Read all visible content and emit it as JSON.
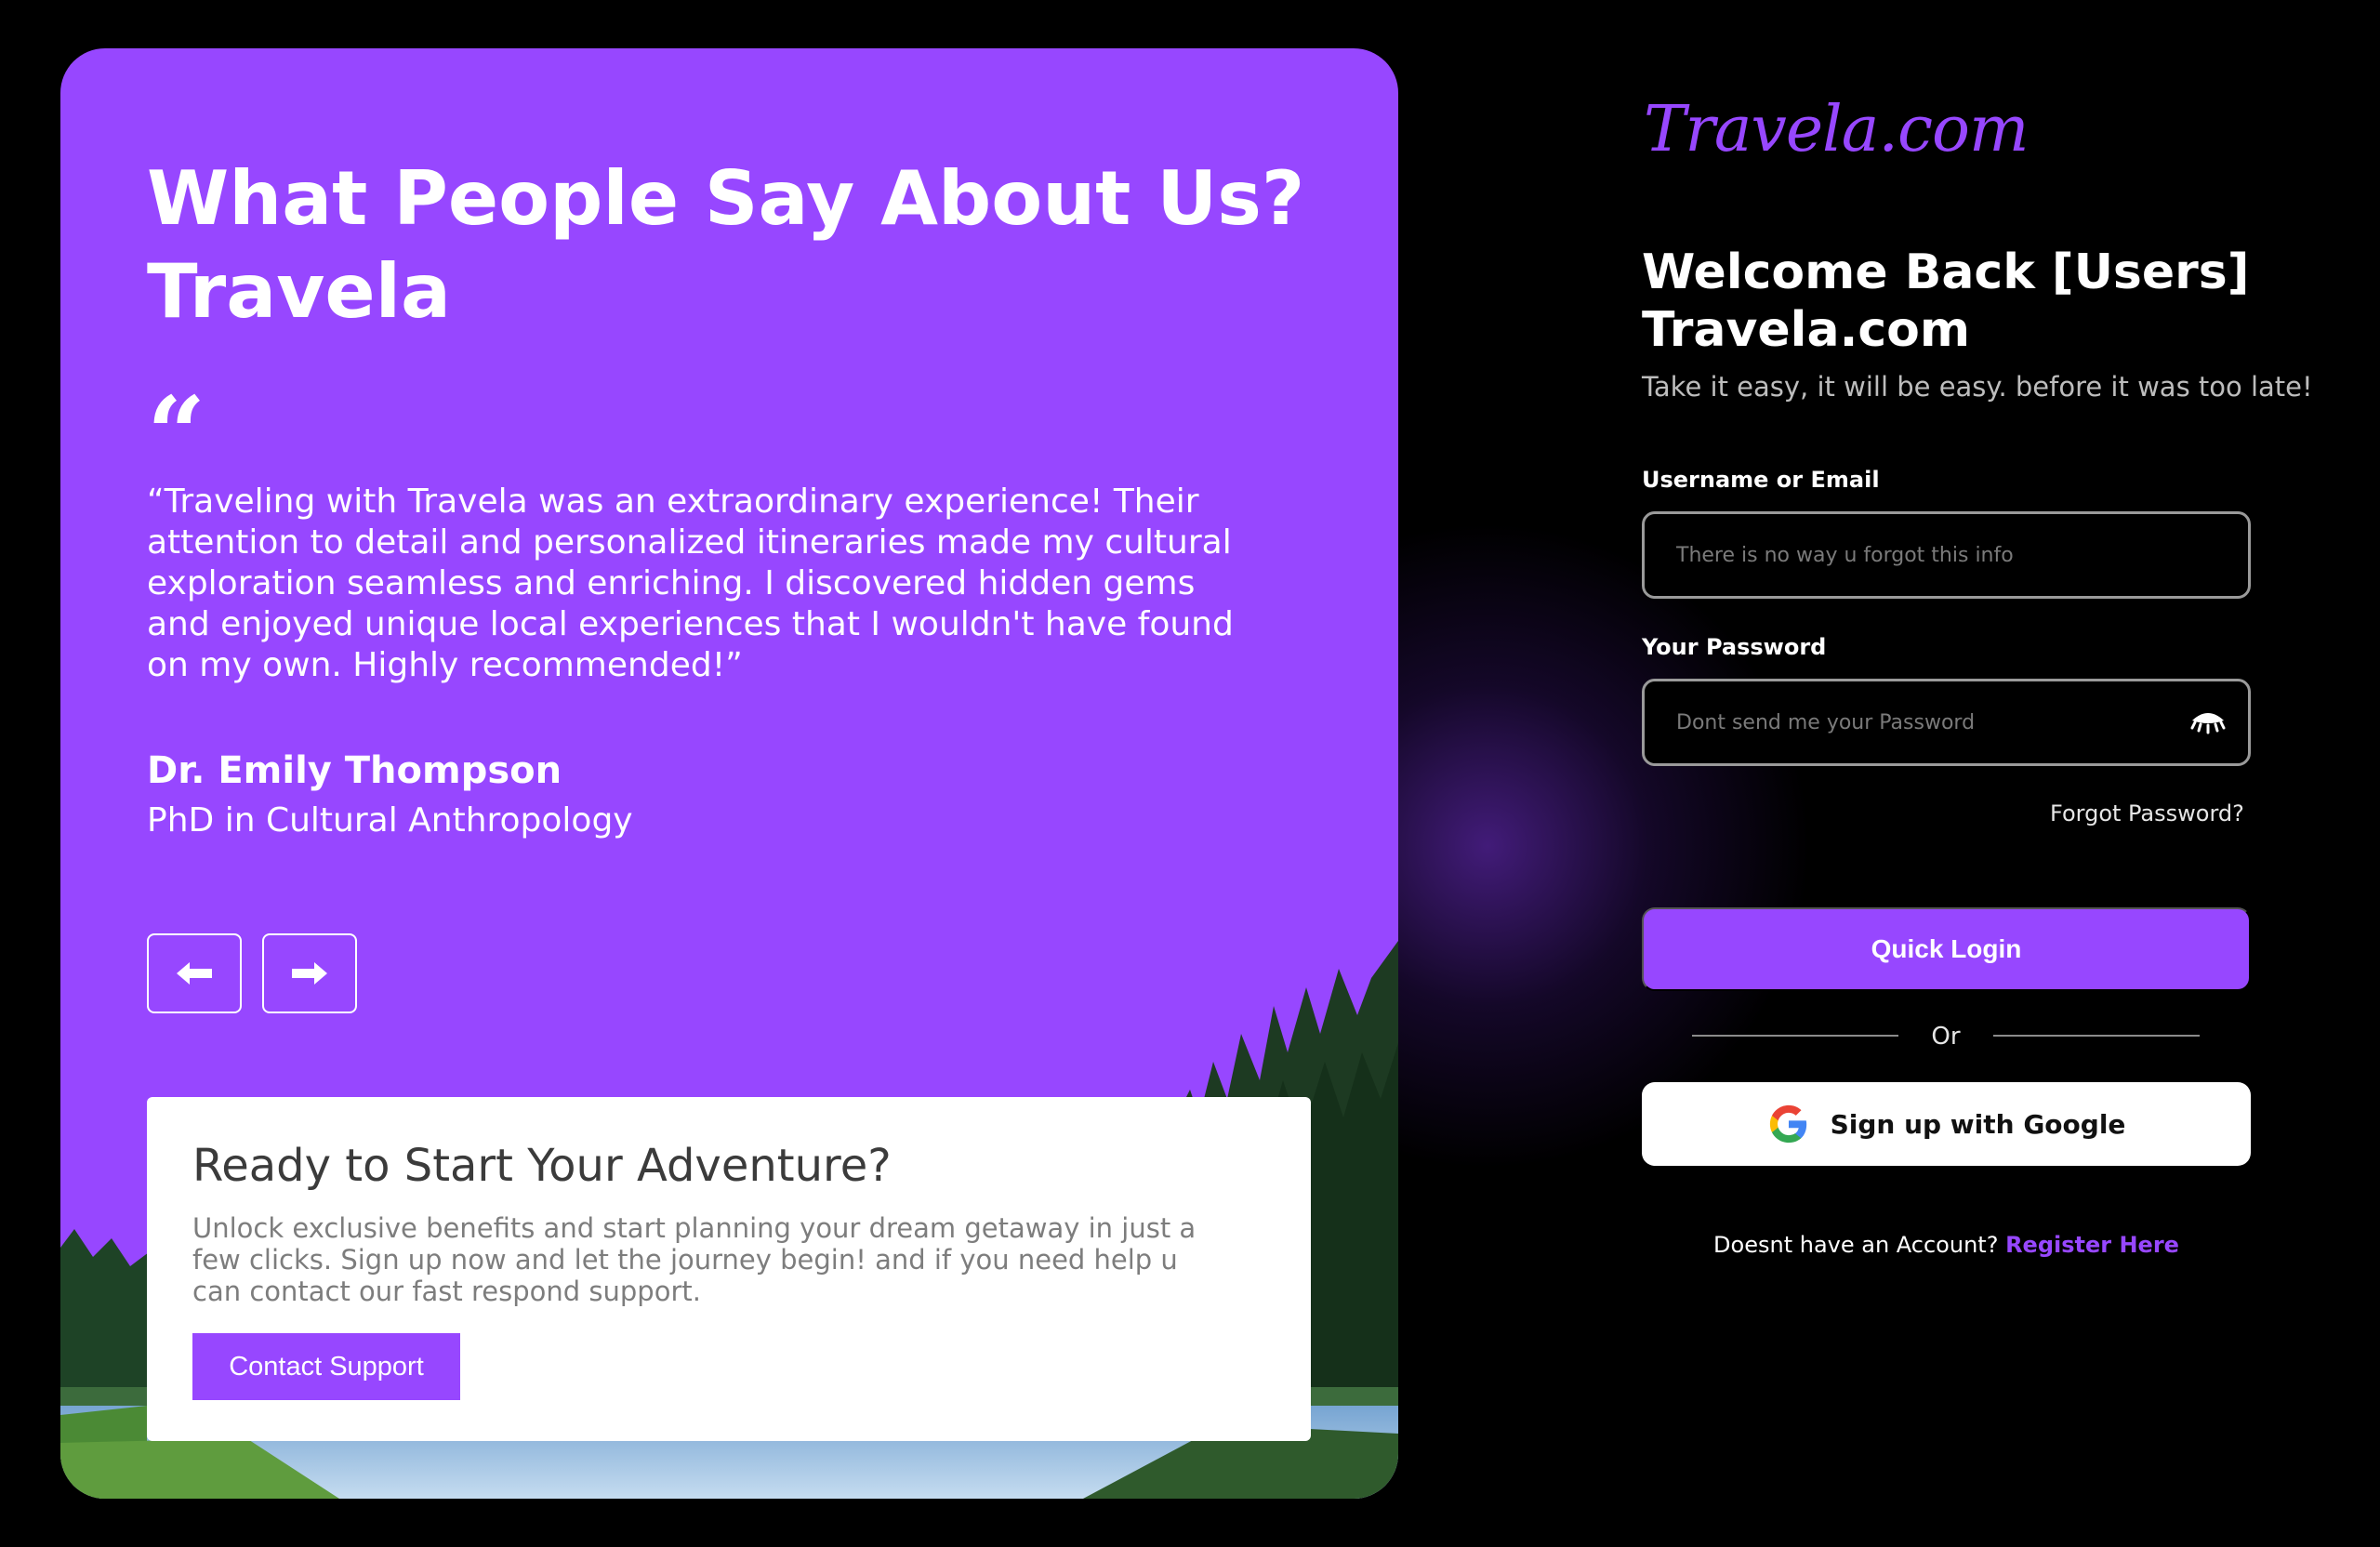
{
  "testimonial": {
    "headline": "What People Say About Us? Travela",
    "quote_mark": "“",
    "quote": "“Traveling with Travela was an extraordinary experience! Their attention to detail and personalized itineraries made my cultural exploration seamless and enriching. I discovered hidden gems and enjoyed unique local experiences that I wouldn't have found on my own. Highly recommended!”",
    "author_name": "Dr. Emily Thompson",
    "author_title": "PhD in Cultural Anthropology",
    "prev_icon": "arrow-left-icon",
    "next_icon": "arrow-right-icon"
  },
  "promo": {
    "title": "Ready to Start Your Adventure?",
    "text": "Unlock exclusive benefits and start planning your dream getaway in just a few clicks. Sign up now and let the journey begin! and if you need help u can contact our fast respond support.",
    "button_label": "Contact Support"
  },
  "login": {
    "logo": "Travela.com",
    "welcome_title": "Welcome Back [Users] Travela.com",
    "subtitle": "Take it easy, it will be easy. before it was too late!",
    "username_label": "Username or Email",
    "username_placeholder": "There is no way u forgot this info",
    "password_label": "Your Password",
    "password_placeholder": "Dont send me your Password",
    "forgot_label": "Forgot Password?",
    "quick_login_label": "Quick Login",
    "or_label": "Or",
    "google_label": "Sign up with Google",
    "register_prompt": "Doesnt have an Account?",
    "register_link": "Register Here"
  },
  "colors": {
    "accent": "#9747ff",
    "background": "#000000",
    "card_white": "#ffffff"
  }
}
